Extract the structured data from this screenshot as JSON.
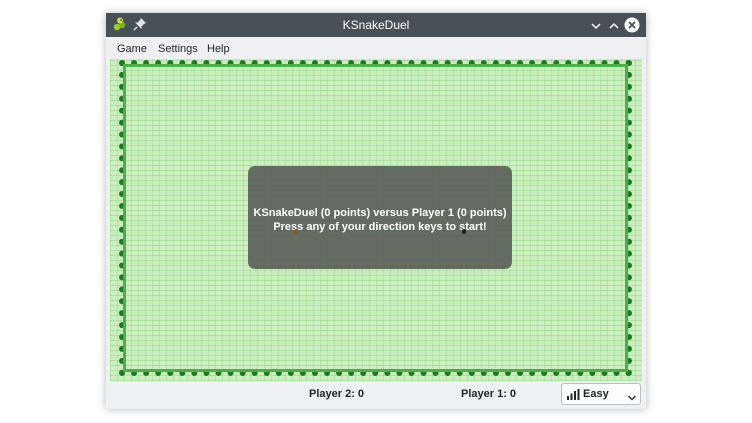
{
  "window": {
    "title": "KSnakeDuel",
    "icons": [
      "ksnakeduel-app-icon",
      "pin-icon",
      "minimize-chevron-icon",
      "maximize-chevron-icon",
      "close-icon"
    ]
  },
  "menubar": {
    "items": [
      "Game",
      "Settings",
      "Help"
    ]
  },
  "game": {
    "message_line1": "KSnakeDuel (0 points) versus Player 1 (0 points)",
    "message_line2": "Press any of your direction keys to start!",
    "colors": {
      "background": "#cbefbf",
      "wall": "#1f7a1f",
      "overlay": "#555a55",
      "player_left_start": "#8a5a1a",
      "player_right_start": "#222222"
    }
  },
  "statusbar": {
    "player2": "Player 2: 0",
    "player1": "Player 1: 0",
    "difficulty": "Easy",
    "difficulty_icon": "difficulty-level-icon"
  }
}
